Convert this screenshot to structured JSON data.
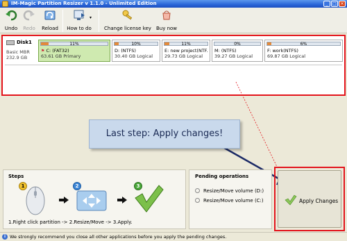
{
  "window": {
    "title": "IM-Magic Partition Resizer v 1.1.0 - Unlimited Edition"
  },
  "toolbar": {
    "items": [
      {
        "label": "Undo",
        "icon": "undo-icon",
        "enabled": true
      },
      {
        "label": "Redo",
        "icon": "redo-icon",
        "enabled": false
      },
      {
        "label": "Reload",
        "icon": "reload-icon",
        "enabled": true
      },
      {
        "label": "How to do",
        "icon": "how-to-icon",
        "enabled": true
      },
      {
        "label": "Change license key",
        "icon": "key-icon",
        "enabled": true
      },
      {
        "label": "Buy now",
        "icon": "cart-icon",
        "enabled": true
      }
    ]
  },
  "disk": {
    "name": "Disk1",
    "type": "Basic MBR",
    "size": "232.9 GB",
    "partitions": [
      {
        "percent": "11%",
        "used_fraction": 0.11,
        "name": "C: (FAT32)",
        "info": "63.61 GB Primary",
        "selected": true
      },
      {
        "percent": "10%",
        "used_fraction": 0.1,
        "name": "D: (NTFS)",
        "info": "30.40 GB Logical",
        "selected": false
      },
      {
        "percent": "11%",
        "used_fraction": 0.11,
        "name": "E: new project(NTF...",
        "info": "29.73 GB Logical",
        "selected": false
      },
      {
        "percent": "0%",
        "used_fraction": 0.0,
        "name": "M: (NTFS)",
        "info": "39.27 GB Logical",
        "selected": false
      },
      {
        "percent": "6%",
        "used_fraction": 0.06,
        "name": "F: work(NTFS)",
        "info": "69.87 GB Logical",
        "selected": false
      }
    ]
  },
  "callout": {
    "text": "Last step: Apply changes!"
  },
  "steps": {
    "heading": "Steps",
    "numbers": [
      "1",
      "2",
      "3"
    ],
    "caption": "1.Right click partition -> 2.Resize/Move -> 3.Apply."
  },
  "pending": {
    "heading": "Pending operations",
    "items": [
      "Resize/Move volume (D:)",
      "Resize/Move volume (C:)"
    ]
  },
  "apply": {
    "label": "Apply Changes"
  },
  "status": {
    "text": "We strongly recommend you close all other applications before you apply the pending changes."
  },
  "colors": {
    "accent_red": "#e3131b",
    "used_bar": "#e38a3a",
    "selected_partition": "#cfeab0",
    "callout_bg": "#c9d9ec"
  }
}
